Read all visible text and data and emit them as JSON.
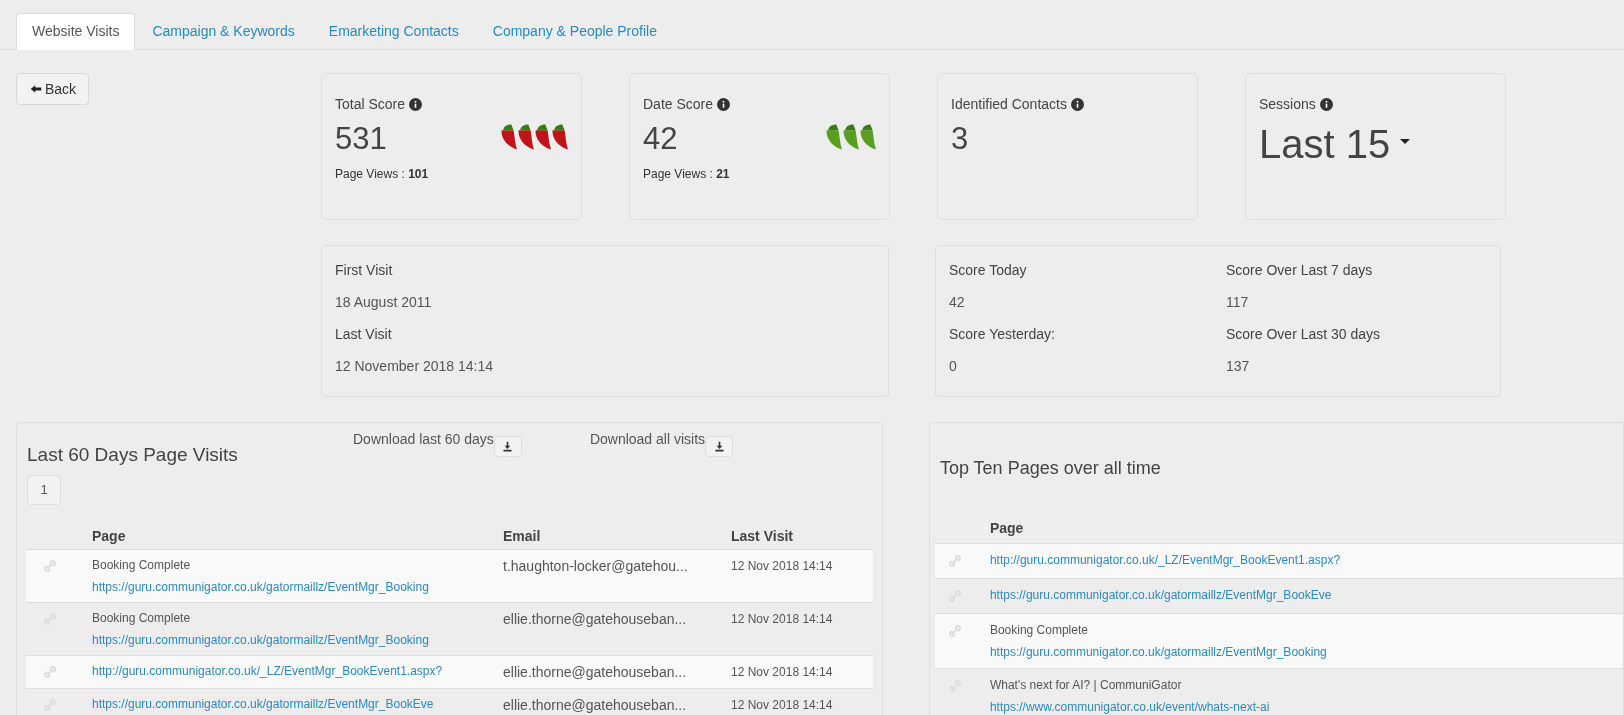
{
  "tabs": [
    {
      "label": "Website Visits",
      "selected": true
    },
    {
      "label": "Campaign & Keywords",
      "selected": false
    },
    {
      "label": "Emarketing Contacts",
      "selected": false
    },
    {
      "label": "Company & People Profile",
      "selected": false
    }
  ],
  "back_button": "Back",
  "score_cards": [
    {
      "kind": "score",
      "label": "Total Score",
      "value": "531",
      "page_views_label": "Page Views : ",
      "page_views": "101",
      "stars": 4,
      "color": "#c0141a"
    },
    {
      "kind": "score",
      "label": "Date Score",
      "value": "42",
      "page_views_label": "Page Views : ",
      "page_views": "21",
      "stars": 3,
      "color": "#5a9e1f"
    },
    {
      "kind": "count",
      "label": "Identified Contacts",
      "value": "3"
    },
    {
      "kind": "dropdown",
      "label": "Sessions",
      "value": "Last 15"
    }
  ],
  "visit_card": [
    {
      "label": "First Visit",
      "value": "18 August 2011"
    },
    {
      "label": "Last Visit",
      "value": "12 November 2018 14:14"
    }
  ],
  "score_summary": [
    {
      "label": "Score Today",
      "value": "42"
    },
    {
      "label": "Score Over Last 7 days",
      "value": "117"
    },
    {
      "label": "Score Yesterday:",
      "value": "0"
    },
    {
      "label": "Score Over Last 30 days",
      "value": "137"
    }
  ],
  "recent_visits": {
    "title": "Last 60 Days Page Visits",
    "downloads": [
      "Download last 60 days",
      "Download all visits"
    ],
    "pages": [
      {
        "label": "1",
        "selected": false
      }
    ],
    "columns": [
      "Page",
      "Email",
      "Last Visit"
    ],
    "rows": [
      {
        "title": "Booking Complete",
        "url": "https://guru.communigator.co.uk/gatormaillz/EventMgr_Booking",
        "email": "t.haughton-locker@gatehou...",
        "last_visit": "12 Nov 2018 14:14"
      },
      {
        "title": "Booking Complete",
        "url": "https://guru.communigator.co.uk/gatormaillz/EventMgr_Booking",
        "email": "ellie.thorne@gatehouseban...",
        "last_visit": "12 Nov 2018 14:14"
      },
      {
        "url": "http://guru.communigator.co.uk/_LZ/EventMgr_BookEvent1.aspx?",
        "email": "ellie.thorne@gatehouseban...",
        "last_visit": "12 Nov 2018 14:14"
      },
      {
        "url": "https://guru.communigator.co.uk/gatormaillz/EventMgr_BookEve",
        "email": "ellie.thorne@gatehouseban...",
        "last_visit": "12 Nov 2018 14:14"
      }
    ]
  },
  "top_pages": {
    "title": "Top Ten Pages over all time",
    "columns": [
      "Page"
    ],
    "rows": [
      {
        "url": "http://guru.communigator.co.uk/_LZ/EventMgr_BookEvent1.aspx?"
      },
      {
        "url": "https://guru.communigator.co.uk/gatormaillz/EventMgr_BookEve"
      },
      {
        "title": "Booking Complete",
        "url": "https://guru.communigator.co.uk/gatormaillz/EventMgr_Booking"
      },
      {
        "title": "What's next for AI? | CommuniGator",
        "url": "https://www.communigator.co.uk/event/whats-next-ai"
      }
    ]
  }
}
